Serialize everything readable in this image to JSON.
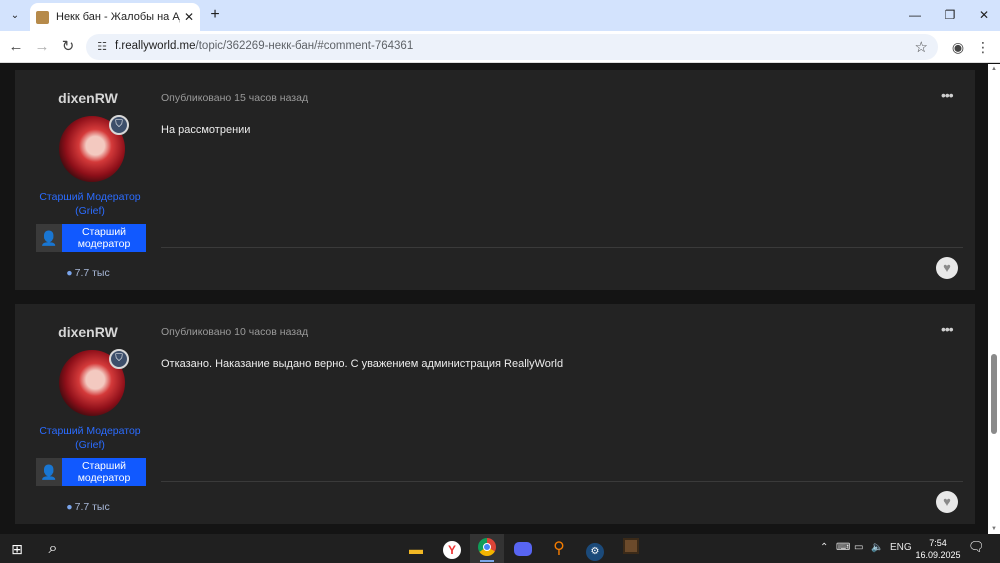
{
  "browser": {
    "tab_title": "Некк бан - Жалобы на Админ",
    "tab_close": "✕",
    "new_tab": "+",
    "url_host": "f.reallyworld.me",
    "url_path": "/topic/362269-некк-бан/#comment-764361"
  },
  "posts": [
    {
      "author": "dixenRW",
      "role": "Старший Модератор (Grief)",
      "group": "Старший модератор",
      "reputation": "7.7 тыс",
      "date": "Опубликовано 15 часов назад",
      "body": "На рассмотрении"
    },
    {
      "author": "dixenRW",
      "role": "Старший Модератор (Grief)",
      "group": "Старший модератор",
      "reputation": "7.7 тыс",
      "date": "Опубликовано 10 часов назад",
      "body": "Отказано. Наказание выдано верно. С уважением администрация ReallyWorld"
    }
  ],
  "taskbar": {
    "lang": "ENG",
    "time": "7:54",
    "date": "16.09.2025"
  },
  "colors": {
    "accent_blue": "#1159ff",
    "role_blue": "#2b6cff",
    "post_bg": "#232323"
  }
}
